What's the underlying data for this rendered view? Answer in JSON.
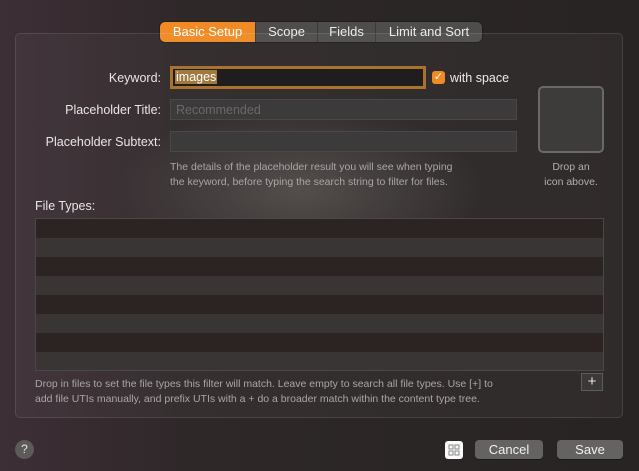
{
  "tabs": [
    {
      "label": "Basic Setup",
      "active": true
    },
    {
      "label": "Scope",
      "active": false
    },
    {
      "label": "Fields",
      "active": false
    },
    {
      "label": "Limit and Sort",
      "active": false
    }
  ],
  "form": {
    "keyword_label": "Keyword:",
    "keyword_value": "images",
    "with_space_label": "with space",
    "with_space_checked": true,
    "placeholder_title_label": "Placeholder Title:",
    "placeholder_title_placeholder": "Recommended",
    "placeholder_subtext_label": "Placeholder Subtext:",
    "placeholder_subtext_value": "",
    "helper_line1": "The details of the placeholder result you will see when typing",
    "helper_line2": "the keyword, before typing the search string to filter for files.",
    "drop_icon_line1": "Drop an",
    "drop_icon_line2": "icon above."
  },
  "file_types": {
    "label": "File Types:",
    "rows": [],
    "description_line1": "Drop in files to set the file types this filter will match. Leave empty to search all file types. Use [+] to",
    "description_line2": "add file UTIs manually, and prefix UTIs with a + do a broader match within the content type tree.",
    "add_label": "+"
  },
  "footer": {
    "help_label": "?",
    "cancel_label": "Cancel",
    "save_label": "Save"
  },
  "colors": {
    "accent": "#f08a25",
    "focus_ring": "#a9722d",
    "button": "#656262"
  },
  "icons": {
    "help": "question-mark-icon",
    "grid": "grid-icon",
    "add": "plus-icon",
    "check": "checkmark-icon"
  }
}
